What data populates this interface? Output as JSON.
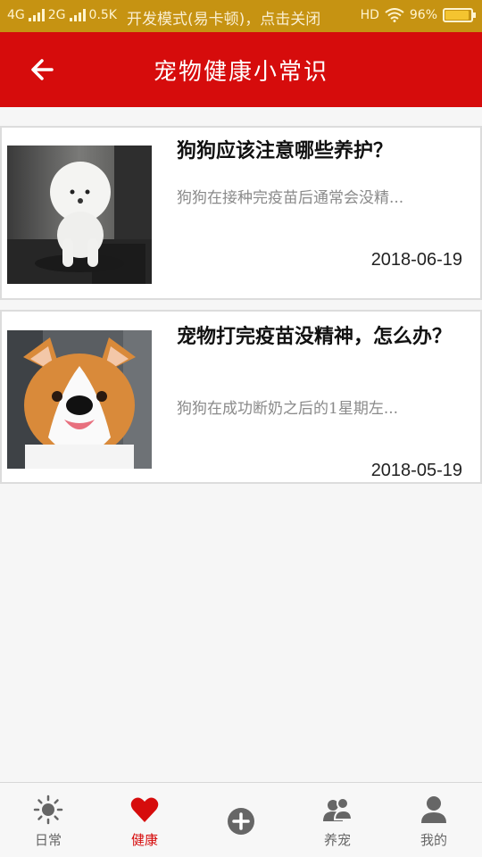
{
  "status_bar": {
    "network_1": "4G",
    "network_2": "2G",
    "speed": "0.5K",
    "notice": "开发模式(易卡顿)，点击关闭",
    "hd": "HD",
    "battery": "96%"
  },
  "app_bar": {
    "title": "宠物健康小常识",
    "back_icon": "arrow-left-icon"
  },
  "articles": [
    {
      "title": "狗狗应该注意哪些养护？",
      "summary": "狗狗在接种完疫苗后通常会没精...",
      "date": "2018-06-19",
      "image": "white-poodle-photo"
    },
    {
      "title": "宠物打完疫苗没精神，怎么办？",
      "summary": "狗狗在成功断奶之后的1星期左...",
      "date": "2018-05-19",
      "image": "corgi-photo"
    }
  ],
  "bottom_nav": [
    {
      "label": "日常",
      "icon": "sun-icon",
      "active": false
    },
    {
      "label": "健康",
      "icon": "heart-icon",
      "active": true
    },
    {
      "label": "",
      "icon": "plus-circle-icon",
      "active": false
    },
    {
      "label": "养宠",
      "icon": "people-icon",
      "active": false
    },
    {
      "label": "我的",
      "icon": "person-icon",
      "active": false
    }
  ],
  "colors": {
    "status_bar": "#c69312",
    "app_bar": "#d60c0c",
    "active_tab": "#d60c0c",
    "inactive_tab": "#666666"
  }
}
